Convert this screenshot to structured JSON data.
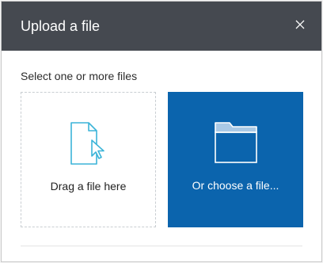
{
  "dialog": {
    "title": "Upload a file",
    "close_icon": "close-icon",
    "subtitle": "Select one or more files"
  },
  "tiles": {
    "drag": {
      "label": "Drag a file here",
      "icon": "file-cursor-icon"
    },
    "choose": {
      "label": "Or choose a file...",
      "icon": "folder-icon"
    }
  },
  "colors": {
    "header_bg": "#454950",
    "accent": "#0b64ad",
    "icon_teal": "#3bb4d8",
    "dashed_border": "#c9ced2"
  }
}
